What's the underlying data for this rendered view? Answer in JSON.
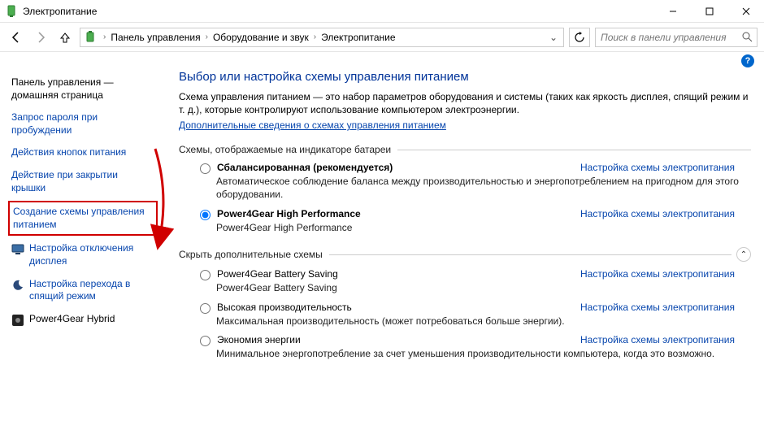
{
  "window": {
    "title": "Электропитание"
  },
  "breadcrumb": {
    "items": [
      "Панель управления",
      "Оборудование и звук",
      "Электропитание"
    ]
  },
  "search": {
    "placeholder": "Поиск в панели управления"
  },
  "sidebar": {
    "home": "Панель управления — домашняя страница",
    "items": [
      "Запрос пароля при пробуждении",
      "Действия кнопок питания",
      "Действие при закрытии крышки",
      "Создание схемы управления питанием",
      "Настройка отключения дисплея",
      "Настройка перехода в спящий режим",
      "Power4Gear Hybrid"
    ]
  },
  "main": {
    "heading": "Выбор или настройка схемы управления питанием",
    "intro": "Схема управления питанием — это набор параметров оборудования и системы (таких как яркость дисплея, спящий режим и т. д.), которые контролируют использование компьютером электроэнергии.",
    "morelink": "Дополнительные сведения о схемах управления питанием",
    "group1": "Схемы, отображаемые на индикаторе батареи",
    "group2": "Скрыть дополнительные схемы",
    "settingslink": "Настройка схемы электропитания",
    "plans": [
      {
        "name": "Сбалансированная (рекомендуется)",
        "desc": "Автоматическое соблюдение баланса между производительностью и энергопотреблением на пригодном для этого оборудовании."
      },
      {
        "name": "Power4Gear High Performance",
        "desc": "Power4Gear High Performance"
      }
    ],
    "extra": [
      {
        "name": "Power4Gear Battery Saving",
        "desc": "Power4Gear Battery Saving"
      },
      {
        "name": "Высокая производительность",
        "desc": "Максимальная производительность (может потребоваться больше энергии)."
      },
      {
        "name": "Экономия энергии",
        "desc": "Минимальное энергопотребление за счет уменьшения производительности компьютера, когда это возможно."
      }
    ]
  }
}
